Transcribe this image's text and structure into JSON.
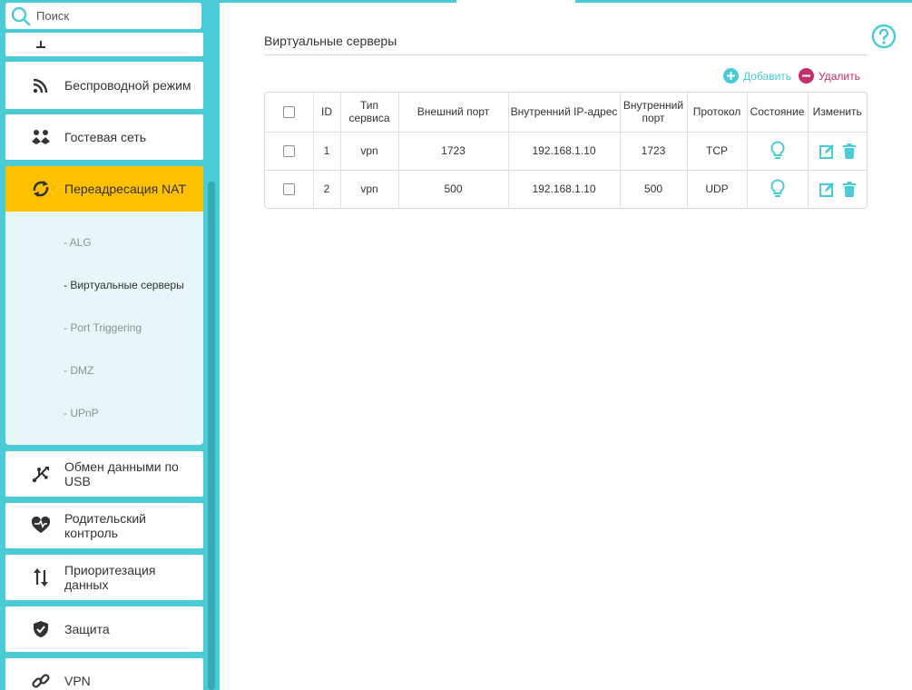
{
  "search": {
    "placeholder": "Поиск"
  },
  "sidebar": {
    "items": [
      {
        "label": "Беспроводной режим",
        "icon": "wifi-icon"
      },
      {
        "label": "Гостевая сеть",
        "icon": "guests-icon"
      },
      {
        "label": "Переадресация NAT",
        "icon": "nat-icon",
        "active": true
      },
      {
        "label": "Обмен данными по USB",
        "icon": "usb-icon"
      },
      {
        "label": "Родительский контроль",
        "icon": "heart-icon"
      },
      {
        "label": "Приоритезация данных",
        "icon": "qos-icon"
      },
      {
        "label": "Защита",
        "icon": "shield-icon"
      },
      {
        "label": "VPN",
        "icon": "link-icon"
      }
    ],
    "nat_submenu": [
      {
        "label": "- ALG"
      },
      {
        "label": "- Виртуальные серверы",
        "active": true
      },
      {
        "label": "- Port Triggering"
      },
      {
        "label": "- DMZ"
      },
      {
        "label": "- UPnP"
      }
    ]
  },
  "main": {
    "title": "Виртуальные серверы",
    "add_label": "Добавить",
    "delete_label": "Удалить",
    "table": {
      "columns": [
        "ID",
        "Тип сервиса",
        "Внешний порт",
        "Внутренний IP-адрес",
        "Внутренний порт",
        "Протокол",
        "Состояние",
        "Изменить"
      ],
      "rows": [
        {
          "id": "1",
          "service": "vpn",
          "ext_port": "1723",
          "int_ip": "192.168.1.10",
          "int_port": "1723",
          "protocol": "TCP"
        },
        {
          "id": "2",
          "service": "vpn",
          "ext_port": "500",
          "int_ip": "192.168.1.10",
          "int_port": "500",
          "protocol": "UDP"
        }
      ]
    }
  },
  "colors": {
    "accent": "#4acbd6",
    "active_nav": "#ffc000",
    "delete": "#c0306a",
    "submenu_bg": "#e7f6f8"
  }
}
